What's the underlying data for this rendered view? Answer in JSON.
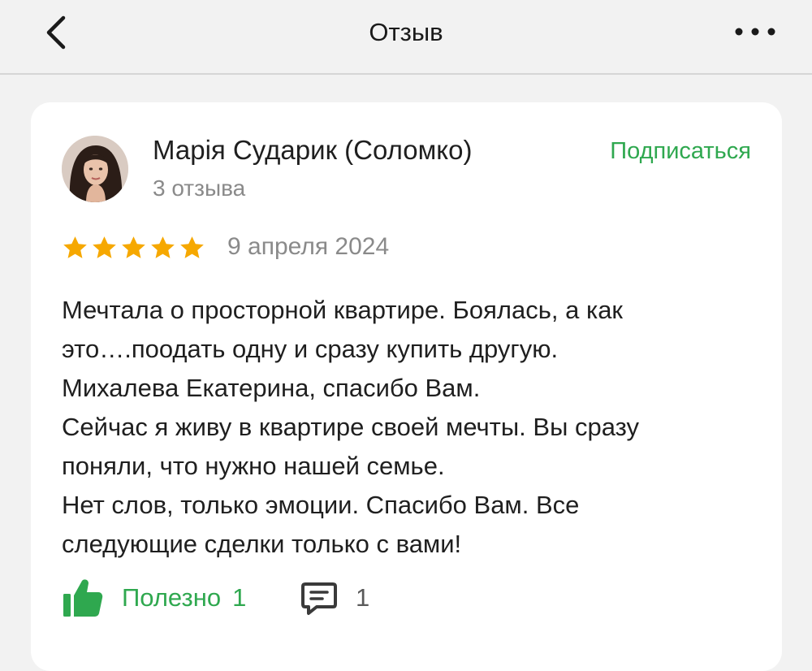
{
  "header": {
    "title": "Отзыв",
    "back_icon": "chevron-left-icon",
    "more_icon": "more-horizontal-icon"
  },
  "review": {
    "author": {
      "name": "Марія Сударик (Соломко)",
      "reviews_count": "3 отзыва",
      "avatar_icon": "avatar-photo"
    },
    "subscribe_label": "Подписаться",
    "rating": 5,
    "rating_max": 5,
    "date": "9 апреля 2024",
    "text_lines": [
      "Мечтала о просторной квартире. Боялась, а как",
      "это….поодать одну и сразу купить другую.",
      "Михалева Екатерина, спасибо Вам.",
      "Сейчас я живу в квартире своей мечты. Вы сразу",
      "поняли, что нужно нашей семье.",
      "Нет слов, только эмоции. Спасибо Вам. Все",
      "следующие сделки только с вами!"
    ],
    "useful_label": "Полезно",
    "useful_count": "1",
    "comments_count": "1"
  },
  "colors": {
    "accent_green": "#2fa84f",
    "star": "#f6a800",
    "muted_text": "#8a8a8a",
    "background": "#f2f2f2",
    "card": "#ffffff"
  }
}
